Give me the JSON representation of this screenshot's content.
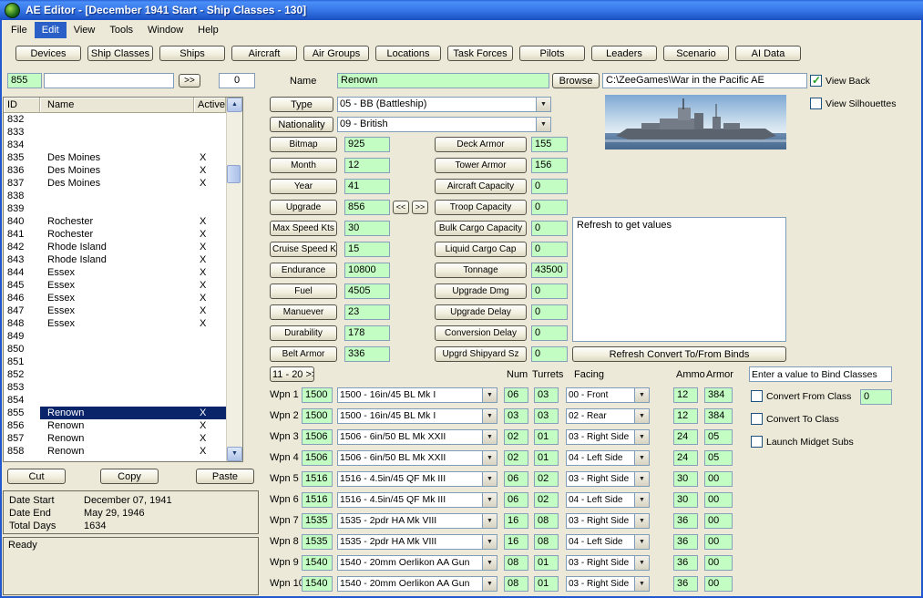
{
  "window": {
    "title": "AE Editor - [December 1941 Start - Ship Classes - 130]"
  },
  "icons": {
    "dropdown_arrow": "▼",
    "check": "✓",
    "scroll_up": "▲",
    "scroll_down": "▼"
  },
  "menu": {
    "items": [
      {
        "label": "File",
        "active": false
      },
      {
        "label": "Edit",
        "active": true
      },
      {
        "label": "View",
        "active": false
      },
      {
        "label": "Tools",
        "active": false
      },
      {
        "label": "Window",
        "active": false
      },
      {
        "label": "Help",
        "active": false
      }
    ]
  },
  "toolbar": {
    "buttons": [
      "Devices",
      "Ship Classes",
      "Ships",
      "Aircraft",
      "Air Groups",
      "Locations",
      "Task Forces",
      "Pilots",
      "Leaders",
      "Scenario",
      "AI Data"
    ]
  },
  "nav": {
    "id_value": "855",
    "filter_value": "",
    "go_label": ">>",
    "count_value": "0"
  },
  "list": {
    "headers": {
      "id": "ID",
      "name": "Name",
      "active": "Active"
    },
    "rows": [
      {
        "id": "832",
        "name": "",
        "flag": ""
      },
      {
        "id": "833",
        "name": "",
        "flag": ""
      },
      {
        "id": "834",
        "name": "",
        "flag": ""
      },
      {
        "id": "835",
        "name": "Des Moines",
        "flag": "X"
      },
      {
        "id": "836",
        "name": "Des Moines",
        "flag": "X"
      },
      {
        "id": "837",
        "name": "Des Moines",
        "flag": "X"
      },
      {
        "id": "838",
        "name": "",
        "flag": ""
      },
      {
        "id": "839",
        "name": "",
        "flag": ""
      },
      {
        "id": "840",
        "name": "Rochester",
        "flag": "X"
      },
      {
        "id": "841",
        "name": "Rochester",
        "flag": "X"
      },
      {
        "id": "842",
        "name": "Rhode Island",
        "flag": "X"
      },
      {
        "id": "843",
        "name": "Rhode Island",
        "flag": "X"
      },
      {
        "id": "844",
        "name": "Essex",
        "flag": "X"
      },
      {
        "id": "845",
        "name": "Essex",
        "flag": "X"
      },
      {
        "id": "846",
        "name": "Essex",
        "flag": "X"
      },
      {
        "id": "847",
        "name": "Essex",
        "flag": "X"
      },
      {
        "id": "848",
        "name": "Essex",
        "flag": "X"
      },
      {
        "id": "849",
        "name": "",
        "flag": ""
      },
      {
        "id": "850",
        "name": "",
        "flag": ""
      },
      {
        "id": "851",
        "name": "",
        "flag": ""
      },
      {
        "id": "852",
        "name": "",
        "flag": ""
      },
      {
        "id": "853",
        "name": "",
        "flag": ""
      },
      {
        "id": "854",
        "name": "",
        "flag": ""
      },
      {
        "id": "855",
        "name": "Renown",
        "flag": "X",
        "selected": true
      },
      {
        "id": "856",
        "name": "Renown",
        "flag": "X"
      },
      {
        "id": "857",
        "name": "Renown",
        "flag": "X"
      },
      {
        "id": "858",
        "name": "Renown",
        "flag": "X"
      }
    ]
  },
  "clipboard": {
    "cut": "Cut",
    "copy": "Copy",
    "paste": "Paste"
  },
  "dates": {
    "rows": [
      {
        "label": "Date Start",
        "value": "December 07, 1941"
      },
      {
        "label": "Date End",
        "value": "May 29, 1946"
      },
      {
        "label": "Total Days",
        "value": "1634"
      }
    ]
  },
  "status": {
    "text": "Ready"
  },
  "header_form": {
    "name_label": "Name",
    "name_value": "Renown",
    "browse_label": "Browse",
    "path_value": "C:\\ZeeGames\\War in the Pacific AE",
    "view_back": {
      "label": "View Back",
      "checked": true
    },
    "view_silhouettes": {
      "label": "View Silhouettes",
      "checked": false
    },
    "type": {
      "label": "Type",
      "value": "05 - BB (Battleship)"
    },
    "nationality": {
      "label": "Nationality",
      "value": "09 - British"
    }
  },
  "upgrade_nav": {
    "prev": "<<",
    "next": ">>"
  },
  "stats_left": {
    "rows": [
      {
        "label": "Bitmap",
        "value": "925"
      },
      {
        "label": "Month",
        "value": "12"
      },
      {
        "label": "Year",
        "value": "41"
      },
      {
        "label": "Upgrade",
        "value": "856"
      },
      {
        "label": "Max Speed Kts",
        "value": "30"
      },
      {
        "label": "Cruise Speed Kts",
        "value": "15"
      },
      {
        "label": "Endurance",
        "value": "10800"
      },
      {
        "label": "Fuel",
        "value": "4505"
      },
      {
        "label": "Manuever",
        "value": "23"
      },
      {
        "label": "Durability",
        "value": "178"
      },
      {
        "label": "Belt Armor",
        "value": "336"
      }
    ]
  },
  "stats_right": {
    "rows": [
      {
        "label": "Deck Armor",
        "value": "155"
      },
      {
        "label": "Tower Armor",
        "value": "156"
      },
      {
        "label": "Aircraft Capacity",
        "value": "0"
      },
      {
        "label": "Troop Capacity",
        "value": "0"
      },
      {
        "label": "Bulk Cargo Capacity",
        "value": "0"
      },
      {
        "label": "Liquid Cargo Cap",
        "value": "0"
      },
      {
        "label": "Tonnage",
        "value": "43500"
      },
      {
        "label": "Upgrade Dmg",
        "value": "0"
      },
      {
        "label": "Upgrade Delay",
        "value": "0"
      },
      {
        "label": "Conversion Delay",
        "value": "0"
      },
      {
        "label": "Upgrd Shipyard Sz",
        "value": "0"
      }
    ]
  },
  "binds_panel": {
    "info_text": "Refresh to get values",
    "refresh_button": "Refresh Convert To/From Binds",
    "bind_prompt": "Enter a value to Bind Classes",
    "convert_from": {
      "label": "Convert From Class",
      "checked": false,
      "value": "0"
    },
    "convert_to": {
      "label": "Convert To Class",
      "checked": false
    },
    "launch_midget": {
      "label": "Launch Midget Subs",
      "checked": false
    }
  },
  "weapons": {
    "page_button": "11 - 20 >>",
    "headers": {
      "num": "Num",
      "turrets": "Turrets",
      "facing": "Facing",
      "ammo": "Ammo",
      "armor": "Armor"
    },
    "rows": [
      {
        "label": "Wpn 1",
        "id": "1500",
        "desc": "1500 - 16in/45 BL Mk I",
        "num": "06",
        "turrets": "03",
        "facing": "00 - Front",
        "ammo": "12",
        "armor": "384"
      },
      {
        "label": "Wpn 2",
        "id": "1500",
        "desc": "1500 - 16in/45 BL Mk I",
        "num": "03",
        "turrets": "03",
        "facing": "02 - Rear",
        "ammo": "12",
        "armor": "384"
      },
      {
        "label": "Wpn 3",
        "id": "1506",
        "desc": "1506 - 6in/50 BL Mk XXII",
        "num": "02",
        "turrets": "01",
        "facing": "03 - Right Side",
        "ammo": "24",
        "armor": "05"
      },
      {
        "label": "Wpn 4",
        "id": "1506",
        "desc": "1506 - 6in/50 BL Mk XXII",
        "num": "02",
        "turrets": "01",
        "facing": "04 - Left Side",
        "ammo": "24",
        "armor": "05"
      },
      {
        "label": "Wpn 5",
        "id": "1516",
        "desc": "1516 - 4.5in/45 QF Mk III",
        "num": "06",
        "turrets": "02",
        "facing": "03 - Right Side",
        "ammo": "30",
        "armor": "00"
      },
      {
        "label": "Wpn 6",
        "id": "1516",
        "desc": "1516 - 4.5in/45 QF Mk III",
        "num": "06",
        "turrets": "02",
        "facing": "04 - Left Side",
        "ammo": "30",
        "armor": "00"
      },
      {
        "label": "Wpn 7",
        "id": "1535",
        "desc": "1535 - 2pdr HA Mk VIII",
        "num": "16",
        "turrets": "08",
        "facing": "03 - Right Side",
        "ammo": "36",
        "armor": "00"
      },
      {
        "label": "Wpn 8",
        "id": "1535",
        "desc": "1535 - 2pdr HA Mk VIII",
        "num": "16",
        "turrets": "08",
        "facing": "04 - Left Side",
        "ammo": "36",
        "armor": "00"
      },
      {
        "label": "Wpn 9",
        "id": "1540",
        "desc": "1540 - 20mm Oerlikon AA Gun",
        "num": "08",
        "turrets": "01",
        "facing": "03 - Right Side",
        "ammo": "36",
        "armor": "00"
      },
      {
        "label": "Wpn 10",
        "id": "1540",
        "desc": "1540 - 20mm Oerlikon AA Gun",
        "num": "08",
        "turrets": "01",
        "facing": "03 - Right Side",
        "ammo": "36",
        "armor": "00"
      }
    ]
  }
}
